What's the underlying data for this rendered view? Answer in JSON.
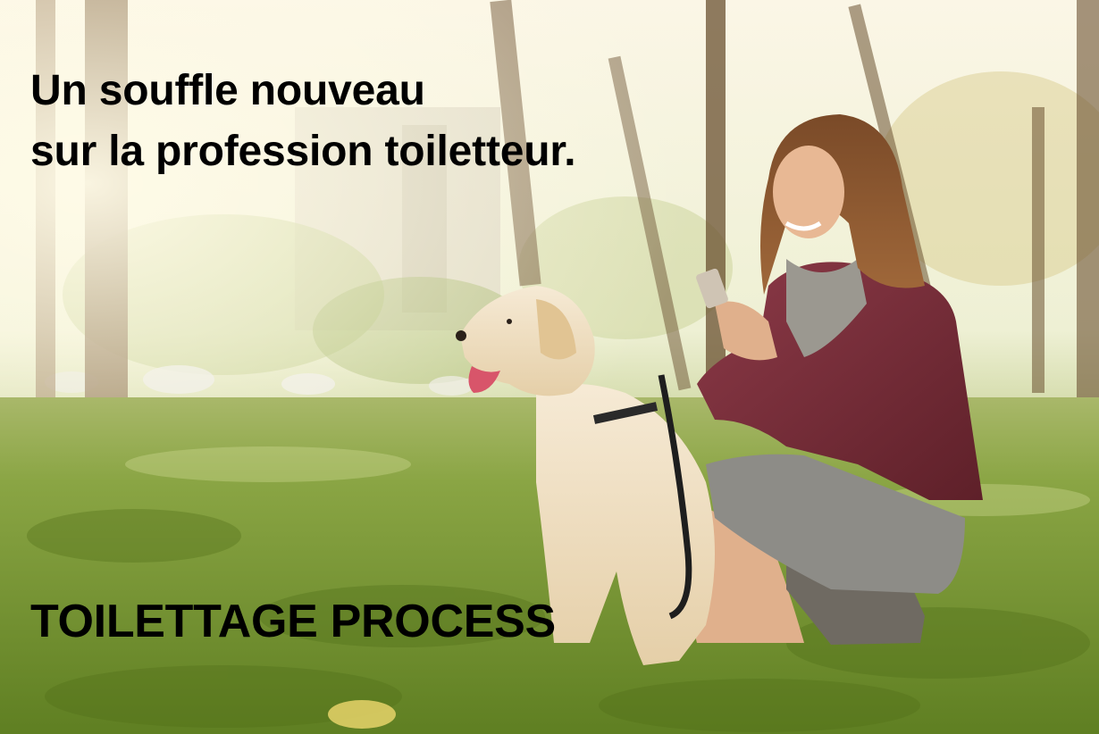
{
  "hero": {
    "headline_line1": "Un souffle nouveau",
    "headline_line2": "sur la profession toiletteur.",
    "brand": "TOILETTAGE PROCESS"
  },
  "colors": {
    "text": "#000000",
    "grass": "#7f9e3a",
    "sky": "#f6efd8",
    "jacket": "#7a2e3a",
    "dress": "#8a8a86",
    "dog_fur": "#efdcc0"
  }
}
